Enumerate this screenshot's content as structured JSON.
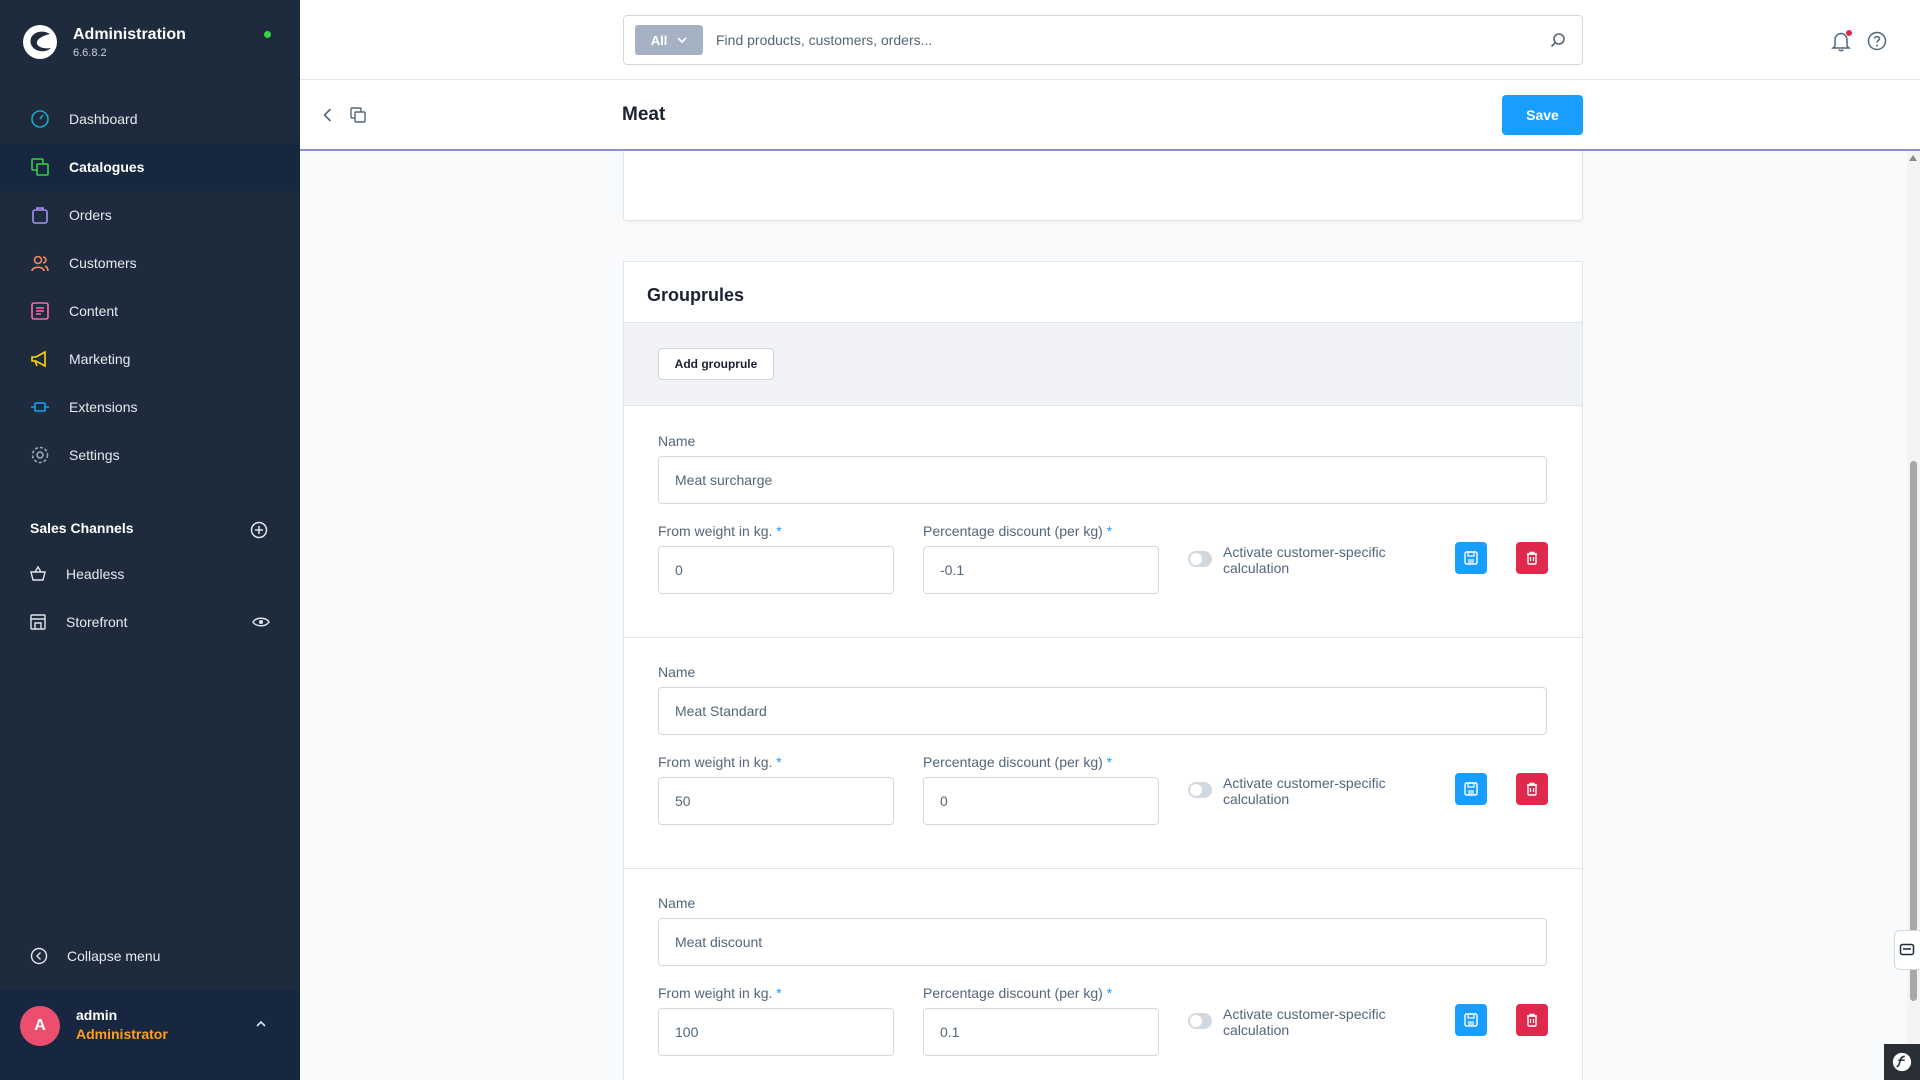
{
  "app": {
    "title": "Administration",
    "version": "6.6.8.2"
  },
  "nav": {
    "items": [
      {
        "label": "Dashboard",
        "icon": "gauge-icon",
        "color": "#18a8c8"
      },
      {
        "label": "Catalogues",
        "icon": "catalogue-icon",
        "color": "#37d046"
      },
      {
        "label": "Orders",
        "icon": "shopping-bag-icon",
        "color": "#a092f0"
      },
      {
        "label": "Customers",
        "icon": "users-icon",
        "color": "#f88962"
      },
      {
        "label": "Content",
        "icon": "content-icon",
        "color": "#ff68b4"
      },
      {
        "label": "Marketing",
        "icon": "megaphone-icon",
        "color": "#ffd700"
      },
      {
        "label": "Extensions",
        "icon": "plug-icon",
        "color": "#189eff"
      },
      {
        "label": "Settings",
        "icon": "gear-icon",
        "color": "#9aa8b5"
      }
    ],
    "active": "Catalogues"
  },
  "sales_channels": {
    "title": "Sales Channels",
    "items": [
      {
        "label": "Headless"
      },
      {
        "label": "Storefront"
      }
    ]
  },
  "collapse_label": "Collapse menu",
  "user": {
    "initial": "A",
    "name": "admin",
    "role": "Administrator"
  },
  "search": {
    "filter": "All",
    "placeholder": "Find products, customers, orders..."
  },
  "smartbar": {
    "title": "Meat",
    "save_label": "Save"
  },
  "grouprules": {
    "title": "Grouprules",
    "add_label": "Add grouprule",
    "name_label": "Name",
    "weight_label": "From weight in kg.",
    "discount_label": "Percentage discount (per kg)",
    "required_mark": "*",
    "toggle_label": "Activate customer-specific calculation",
    "rules": [
      {
        "name": "Meat surcharge",
        "weight": "0",
        "discount": "-0.1"
      },
      {
        "name": "Meat Standard",
        "weight": "50",
        "discount": "0"
      },
      {
        "name": "Meat discount",
        "weight": "100",
        "discount": "0.1"
      }
    ]
  },
  "colors": {
    "sidebar": "#1e2b3c",
    "primary": "#189eff",
    "danger": "#de294c",
    "role": "#ff9f1c"
  }
}
